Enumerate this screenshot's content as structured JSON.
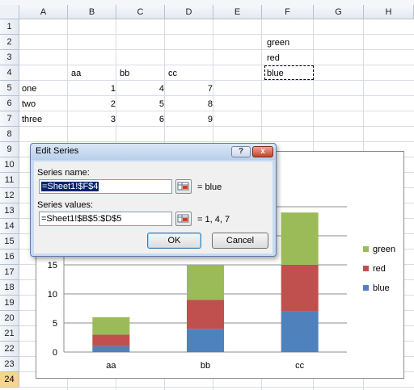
{
  "sheet": {
    "columns": [
      "A",
      "B",
      "C",
      "D",
      "E",
      "F",
      "G",
      "H"
    ],
    "rows": [
      "1",
      "2",
      "3",
      "4",
      "5",
      "6",
      "7",
      "8",
      "9",
      "10",
      "11",
      "12",
      "13",
      "14",
      "15",
      "16",
      "17",
      "18",
      "19",
      "20",
      "21",
      "22",
      "23",
      "24"
    ],
    "selected_row": "24",
    "cells": {
      "F2": "green",
      "F3": "red",
      "F4": "blue",
      "B4": "aa",
      "C4": "bb",
      "D4": "cc",
      "A5": "one",
      "B5": "1",
      "C5": "4",
      "D5": "7",
      "A6": "two",
      "B6": "2",
      "C6": "5",
      "D6": "8",
      "A7": "three",
      "B7": "3",
      "C7": "6",
      "D7": "9"
    }
  },
  "dialog": {
    "title": "Edit Series",
    "help_glyph": "?",
    "close_glyph": "x",
    "series_name_label": "Series name:",
    "series_name_value": "=Sheet1!$F$4",
    "series_name_result": "= blue",
    "series_values_label": "Series values:",
    "series_values_value": "=Sheet1!$B$5:$D$5",
    "series_values_result": "= 1, 4, 7",
    "ok_label": "OK",
    "cancel_label": "Cancel",
    "ref_icon": "range-select-icon"
  },
  "chart_data": {
    "type": "bar",
    "stacked": true,
    "categories": [
      "aa",
      "bb",
      "cc"
    ],
    "series": [
      {
        "name": "blue",
        "values": [
          1,
          4,
          7
        ],
        "color": "#4f81bd"
      },
      {
        "name": "red",
        "values": [
          2,
          5,
          8
        ],
        "color": "#c0504d"
      },
      {
        "name": "green",
        "values": [
          3,
          6,
          9
        ],
        "color": "#9bbb59"
      }
    ],
    "ylim": [
      0,
      25
    ],
    "yticks": [
      "0",
      "5",
      "10",
      "15"
    ],
    "grid": true,
    "legend": "right"
  }
}
